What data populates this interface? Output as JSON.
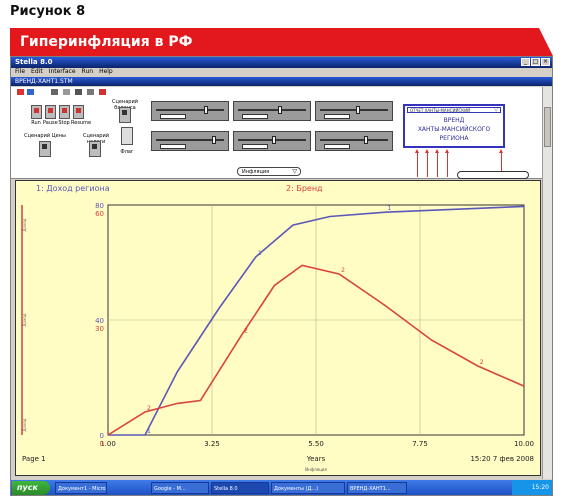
{
  "figure_label": "Рисунок 8",
  "banner_title": "Гиперинфляция в РФ",
  "app": {
    "title": "Stella 8.0",
    "document": "ВРЕНД-ХАНТ1.STM",
    "menu": [
      "File",
      "Edit",
      "Interface",
      "Run",
      "Help"
    ]
  },
  "model": {
    "run_buttons": [
      "Run",
      "Pause",
      "Stop",
      "Resume"
    ],
    "labels": {
      "scenario_prices": "Сценарий Цены",
      "scenario_tax": "Сценарий налоги",
      "scenario_balance": "Сценарий баланса",
      "flag_label": "Флаг"
    },
    "box": {
      "header": "ОТЧЕТ ХАНТЫ-МАНСИЙСКИЙ",
      "lines": [
        "ВРЕНД",
        "ХАНТЫ-МАНСИЙСКОГО",
        "РЕГИОНА"
      ]
    },
    "dropdown_value": "Инфляция"
  },
  "graph": {
    "page_label": "Page 1",
    "footer_mark": "Инфляция",
    "left_axis_labels": [
      "Доход",
      "Доход",
      "Доход"
    ],
    "timestamp": "15:20   7 фев 2008"
  },
  "chart_data": {
    "type": "line",
    "xlabel": "Years",
    "xlim": [
      1,
      10
    ],
    "x_ticks": [
      "1.00",
      "3.25",
      "5.50",
      "7.75",
      "10.00"
    ],
    "y_ticks_left": [
      "80",
      "40",
      "0"
    ],
    "y_ticks_left2": [
      "60",
      "30",
      "0"
    ],
    "ylim": [
      0,
      80
    ],
    "series": [
      {
        "name": "1: Доход региона",
        "color": "#5a58b8",
        "marker": "1",
        "x": [
          1.0,
          1.8,
          2.5,
          3.4,
          4.2,
          5.0,
          5.8,
          7.0,
          8.5,
          10.0
        ],
        "y": [
          0,
          0,
          22,
          44,
          62,
          73,
          76,
          77.5,
          78.5,
          79.5
        ]
      },
      {
        "name": "2: Бренд",
        "color": "#d9433e",
        "marker": "2",
        "x": [
          1.0,
          1.8,
          2.5,
          3.0,
          3.9,
          4.6,
          5.2,
          6.0,
          7.0,
          8.0,
          9.0,
          10.0
        ],
        "y": [
          0,
          8,
          11,
          12,
          35,
          52,
          59,
          56,
          45,
          33,
          24,
          17
        ]
      }
    ]
  },
  "taskbar": {
    "start": "пуск",
    "tasks": [
      "Документ1 - Micros...",
      "Google - M...",
      "Stella 8.0",
      "Документы (Д...)",
      "ВРЕНД-ХАНТ1..."
    ],
    "clock": "15:20"
  }
}
